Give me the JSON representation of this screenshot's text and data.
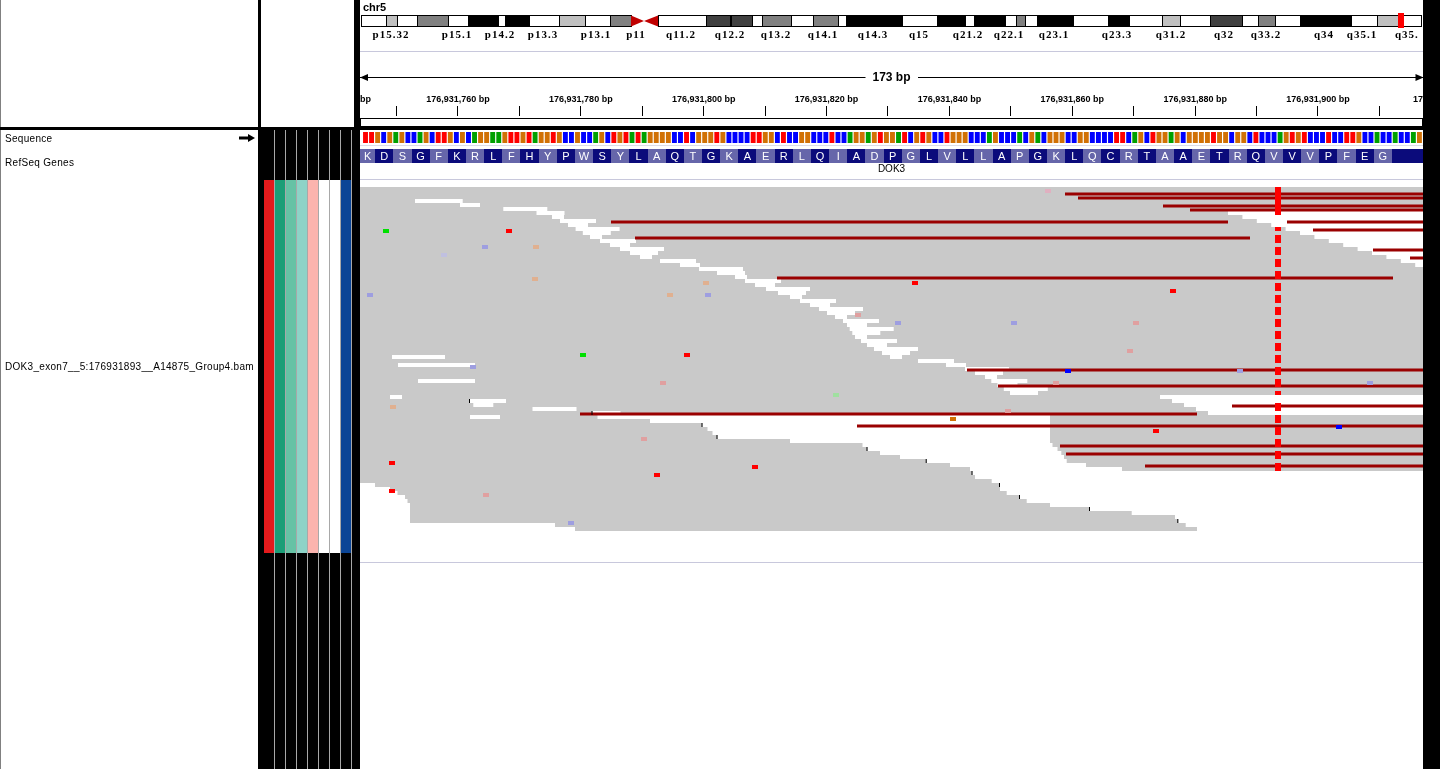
{
  "chromosome": {
    "name": "chr5",
    "bands": [
      "p15.32",
      "p15.1",
      "p14.2",
      "p13.3",
      "p13.1",
      "p11",
      "q11.2",
      "q12.2",
      "q13.2",
      "q14.1",
      "q14.3",
      "q15",
      "q21.2",
      "q22.1",
      "q23.1",
      "q23.3",
      "q31.2",
      "q32",
      "q33.2",
      "q34",
      "q35.1",
      "q35."
    ]
  },
  "ruler": {
    "span": "173 bp",
    "ticks": [
      "bp",
      "176,931,760 bp",
      "176,931,780 bp",
      "176,931,800 bp",
      "176,931,820 bp",
      "176,931,840 bp",
      "176,931,860 bp",
      "176,931,880 bp",
      "176,931,900 bp",
      "17"
    ]
  },
  "tracks": [
    {
      "kind": "sequence",
      "name": "Sequence"
    },
    {
      "kind": "gene",
      "name": "RefSeq Genes",
      "gene": "DOK3",
      "amino_acids": [
        "K",
        "D",
        "S",
        "G",
        "F",
        "K",
        "R",
        "L",
        "F",
        "H",
        "Y",
        "P",
        "W",
        "S",
        "Y",
        "L",
        "A",
        "Q",
        "T",
        "G",
        "K",
        "A",
        "E",
        "R",
        "L",
        "Q",
        "I",
        "A",
        "D",
        "P",
        "G",
        "L",
        "V",
        "L",
        "L",
        "A",
        "P",
        "G",
        "K",
        "L",
        "Q",
        "C",
        "R",
        "T",
        "A",
        "A",
        "E",
        "T",
        "R",
        "Q",
        "V",
        "V",
        "V",
        "P",
        "F",
        "E",
        "G"
      ]
    },
    {
      "kind": "alignment",
      "name": "DOK3_exon7__5:176931893__A14875_Group4.bam",
      "attributes": [
        {
          "color": "#e41a1c"
        },
        {
          "color": "#1b9e77"
        },
        {
          "color": "#66c2a5"
        },
        {
          "color": "#8dd3c7"
        },
        {
          "color": "#fbb4ae"
        },
        {
          "color": "#ffffff"
        },
        {
          "color": "#ffffff"
        },
        {
          "color": "#0b4596"
        }
      ]
    }
  ]
}
